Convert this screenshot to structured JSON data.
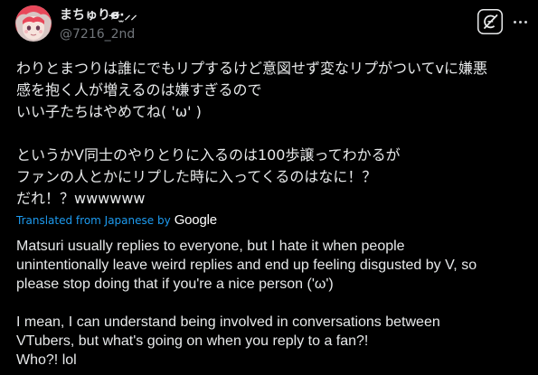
{
  "author": {
    "display_name": "まちゅり",
    "display_name_emoji": "ɞ̴̶̷·̫⸝⸝ ",
    "handle": "@7216_2nd"
  },
  "tweet": {
    "text": "わりとまつりは誰にでもリプするけど意図せず変なリプがついてvに嫌悪\n感を抱く人が増えるのは嫌すぎるので\nいい子たちはやめてね( 'ω' )\n\nというかV同士のやりとりに入るのは100歩譲ってわかるが\nファンの人とかにリプした時に入ってくるのはなに！？\nだれ！？wwwwww"
  },
  "translation": {
    "label": "Translated from Japanese by",
    "provider": "Google",
    "text": "Matsuri usually replies to everyone, but I hate it when people\nunintentionally leave weird replies and end up feeling disgusted by V, so\nplease stop doing that if you're a nice person ('ω')\n\nI mean, I can understand being involved in conversations between\nVTubers, but what's going on when you reply to a fan?!\nWho?! lol"
  },
  "icons": {
    "grok": "grok-icon",
    "more": "more-icon"
  },
  "colors": {
    "background": "#000000",
    "text_primary": "#e7e9ea",
    "text_secondary": "#71767b",
    "link": "#1d9bf0"
  }
}
